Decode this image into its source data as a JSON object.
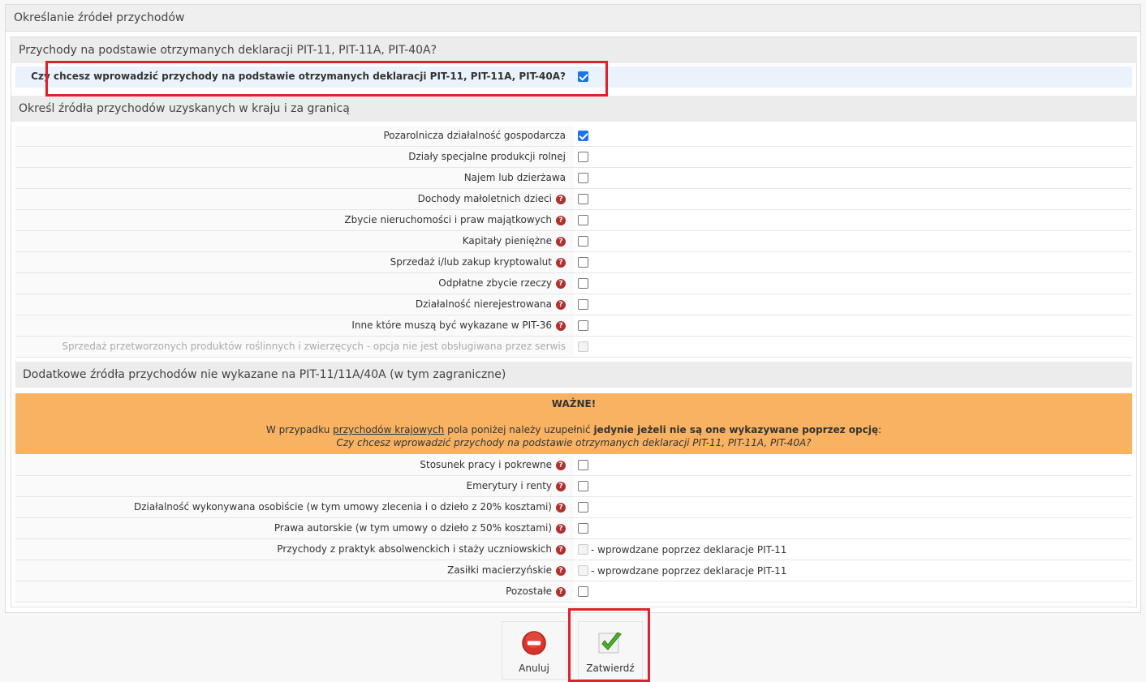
{
  "panel": {
    "title": "Określanie źródeł przychodów"
  },
  "section1": {
    "title": "Przychody na podstawie otrzymanych deklaracji PIT-11, PIT-11A, PIT-40A?",
    "question": "Czy chcesz wprowadzić przychody na podstawie otrzymanych deklaracji PIT-11, PIT-11A, PIT-40A?"
  },
  "section2": {
    "title": "Określ źródła przychodów uzyskanych w kraju i za granicą",
    "items": [
      {
        "label": "Pozarolnicza działalność gospodarcza",
        "checked": true,
        "help": false
      },
      {
        "label": "Działy specjalne produkcji rolnej",
        "checked": false,
        "help": false
      },
      {
        "label": "Najem lub dzierżawa",
        "checked": false,
        "help": false
      },
      {
        "label": "Dochody małoletnich dzieci",
        "checked": false,
        "help": true
      },
      {
        "label": "Zbycie nieruchomości i praw majątkowych",
        "checked": false,
        "help": true
      },
      {
        "label": "Kapitały pieniężne",
        "checked": false,
        "help": true
      },
      {
        "label": "Sprzedaż i/lub zakup kryptowalut",
        "checked": false,
        "help": true
      },
      {
        "label": "Odpłatne zbycie rzeczy",
        "checked": false,
        "help": true
      },
      {
        "label": "Działalność nierejestrowana",
        "checked": false,
        "help": true
      },
      {
        "label": "Inne które muszą być wykazane w PIT-36",
        "checked": false,
        "help": true
      },
      {
        "label": "Sprzedaż przetworzonych produktów roślinnych i zwierzęcych - opcja nie jest obsługiwana przez serwis",
        "checked": false,
        "help": false,
        "disabled": true
      }
    ]
  },
  "section3": {
    "title": "Dodatkowe źródła przychodów nie wykazane na PIT-11/11A/40A (w tym zagraniczne)",
    "warning": {
      "title": "WAŻNE!",
      "text_1": "W przypadku ",
      "link": "przychodów krajowych",
      "text_2": " pola poniżej należy uzupełnić ",
      "bold": "jedynie jeżeli nie są one wykazywane poprzez opcję",
      "text_3": ":",
      "italic": "Czy chcesz wprowadzić przychody na podstawie otrzymanych deklaracji PIT-11, PIT-11A, PIT-40A?"
    },
    "items": [
      {
        "label": "Stosunek pracy i pokrewne",
        "checked": false,
        "help": true
      },
      {
        "label": "Emerytury i renty",
        "checked": false,
        "help": true
      },
      {
        "label": "Działalność wykonywana osobiście (w tym umowy zlecenia i o dzieło z 20% kosztami)",
        "checked": false,
        "help": true
      },
      {
        "label": "Prawa autorskie (w tym umowy o dzieło z 50% kosztami)",
        "checked": false,
        "help": true
      },
      {
        "label": "Przychody z praktyk absolwenckich i staży uczniowskich",
        "checked": false,
        "help": true,
        "disabled": true,
        "note": "- wprowdzane poprzez deklaracje PIT-11"
      },
      {
        "label": "Zasiłki macierzyńskie",
        "checked": false,
        "help": true,
        "disabled": true,
        "note": "- wprowdzane poprzez deklaracje PIT-11"
      },
      {
        "label": "Pozostałe",
        "checked": false,
        "help": true
      }
    ]
  },
  "buttons": {
    "cancel": "Anuluj",
    "confirm": "Zatwierdź"
  },
  "colors": {
    "accent_check": "#1a73e8",
    "warning_bg": "#f8b262",
    "highlight": "#e0202a",
    "help_icon": "#b03030"
  }
}
